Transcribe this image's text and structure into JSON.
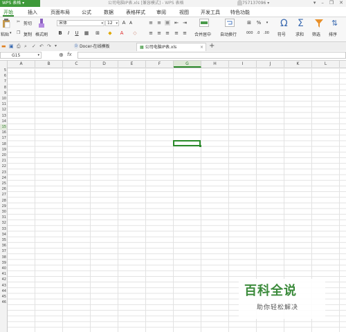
{
  "app": {
    "logo_text": "WPS 表格 ▾",
    "doc_title": "公司电脑IP表.xls [兼容模式] - WPS 表格",
    "user": "757137096 ▾"
  },
  "window_buttons": [
    "▾",
    "–",
    "❐",
    "✕"
  ],
  "menu": {
    "items": [
      "开始",
      "插入",
      "页面布局",
      "公式",
      "数据",
      "表格样式",
      "审阅",
      "视图",
      "开发工具",
      "特色功能"
    ],
    "active": "开始"
  },
  "ribbon": {
    "paste_label": "粘贴",
    "cut_label": "剪切",
    "copy_label": "复制",
    "format_painter_label": "格式刷",
    "font_name": "宋体",
    "font_size": "12",
    "bold": "B",
    "italic": "I",
    "underline": "U",
    "merge_center_label": "合并居中",
    "wrap_label": "自动换行",
    "percent_label": "%",
    "symbol_label": "符号",
    "sum_label": "求和",
    "filter_label": "筛选",
    "sort_label": "排序"
  },
  "tabs": [
    {
      "label": "Docer-在线模板",
      "active": false
    },
    {
      "label": "公司电脑IP表.xls",
      "active": true
    }
  ],
  "formula_bar": {
    "cell_ref": "G15",
    "fx": "fx",
    "value": ""
  },
  "columns": [
    "A",
    "B",
    "C",
    "D",
    "E",
    "F",
    "G",
    "H",
    "I",
    "J",
    "K",
    "L"
  ],
  "selected_column": "G",
  "rows": [
    "5",
    "6",
    "7",
    "8",
    "9",
    "10",
    "11",
    "12",
    "13",
    "14",
    "15",
    "16",
    "17",
    "18",
    "19",
    "20",
    "21",
    "22",
    "23",
    "24",
    "25",
    "26",
    "27",
    "28",
    "29",
    "30",
    "31",
    "32",
    "33",
    "34",
    "35",
    "36",
    "37",
    "38",
    "39",
    "40",
    "41",
    "42",
    "43",
    "44",
    "45",
    "46"
  ],
  "selected_row": "15",
  "watermark": {
    "title": "百科全说",
    "subtitle": "助你轻松解决"
  },
  "colors": {
    "accent": "#2a8a2a",
    "logo_bg": "#3e9a3a"
  }
}
